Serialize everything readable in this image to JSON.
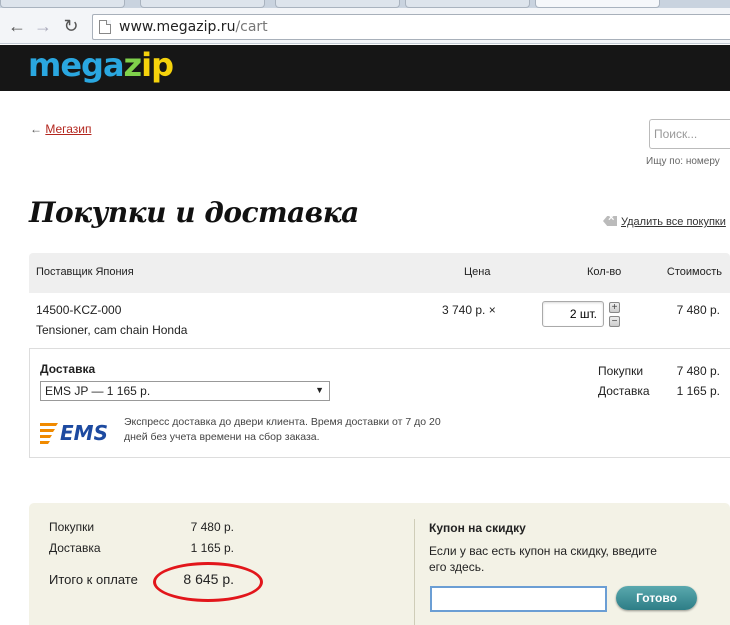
{
  "browser": {
    "url_host": "www.megazip.ru",
    "url_path": "/cart",
    "back_icon": "←",
    "forward_icon": "→",
    "reload_icon": "↻"
  },
  "header": {
    "logo": {
      "part1": "mega",
      "part2": "z",
      "part3": "ip"
    }
  },
  "nav": {
    "back_arrow": "←",
    "back_link": "Мегазип",
    "search_placeholder": "Поиск...",
    "search_hint": "Ищу по: номеру"
  },
  "page": {
    "title": "Покупки и доставка",
    "clear_all": "Удалить все покупки"
  },
  "cart": {
    "headers": {
      "supplier": "Поставщик Япония",
      "price": "Цена",
      "qty": "Кол-во",
      "cost": "Стоимость"
    },
    "items": [
      {
        "part_no": "14500-KCZ-000",
        "name": "Tensioner, cam chain Honda",
        "price": "3 740 р. ×",
        "qty": "2 шт.",
        "cost": "7 480 р."
      }
    ]
  },
  "delivery": {
    "label": "Доставка",
    "method": "EMS JP — 1 165 р.",
    "select_arrow": "▼",
    "logo_text": "EMS",
    "description": "Экспресс доставка до двери клиента. Время доставки от 7 до 20 дней без учета времени на сбор заказа.",
    "purchases_label": "Покупки",
    "purchases_value": "7 480 р.",
    "delivery_label": "Доставка",
    "delivery_value": "1 165 р."
  },
  "totals": {
    "purchases_label": "Покупки",
    "purchases_value": "7 480 р.",
    "delivery_label": "Доставка",
    "delivery_value": "1 165 р.",
    "grand_label": "Итого к оплате",
    "grand_value": "8 645 р."
  },
  "coupon": {
    "title": "Купон на скидку",
    "text": "Если у вас есть купон на скидку, введите его здесь.",
    "value": "",
    "button": "Готово"
  },
  "colors": {
    "accent_link": "#b3261e",
    "highlight_ellipse": "#e2161b",
    "button": "#2d7d86"
  }
}
